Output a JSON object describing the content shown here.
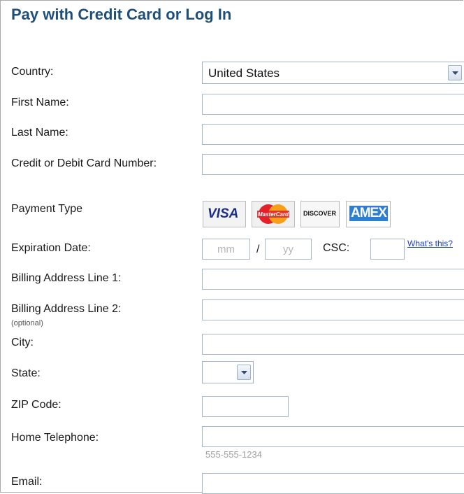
{
  "title": "Pay with Credit Card or Log In",
  "country": {
    "label": "Country:",
    "value": "United States"
  },
  "first_name": {
    "label": "First Name:"
  },
  "last_name": {
    "label": "Last Name:"
  },
  "card_number": {
    "label": "Credit or Debit Card Number:"
  },
  "payment_type": {
    "label": "Payment Type",
    "cards": {
      "visa": "VISA",
      "mastercard": "MasterCard",
      "discover": "DISCOVER",
      "amex": "AMEX"
    }
  },
  "expiration": {
    "label": "Expiration Date:",
    "month_placeholder": "mm",
    "separator": "/",
    "year_placeholder": "yy",
    "csc_label": "CSC:",
    "whats_this": "What's this?"
  },
  "address1": {
    "label": "Billing Address Line 1:"
  },
  "address2": {
    "label": "Billing Address Line 2:",
    "note": "(optional)"
  },
  "city": {
    "label": "City:"
  },
  "state": {
    "label": "State:"
  },
  "zip": {
    "label": "ZIP Code:"
  },
  "phone": {
    "label": "Home Telephone:",
    "hint": "555-555-1234"
  },
  "email": {
    "label": "Email:"
  }
}
